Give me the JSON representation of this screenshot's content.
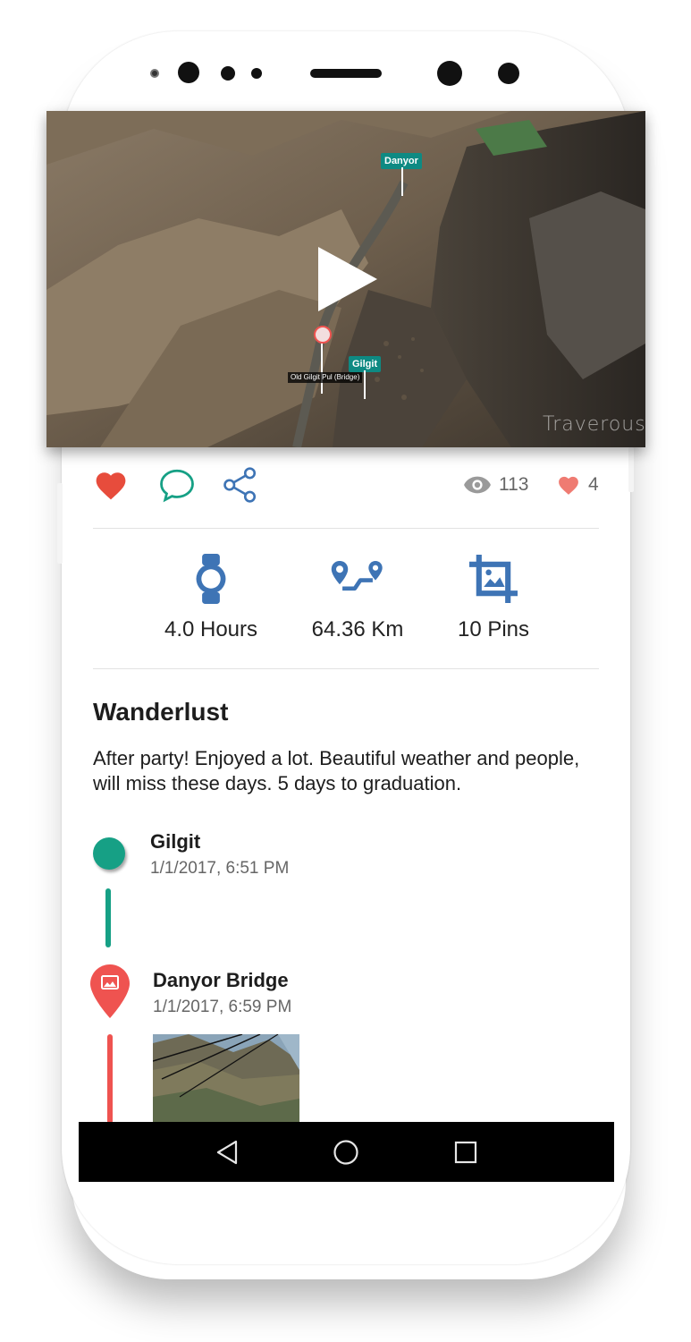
{
  "video": {
    "labels": {
      "danyor": "Danyor",
      "gilgit": "Gilgit",
      "bridge": "Old Gilgit Pul (Bridge)"
    },
    "watermark": "Traverous"
  },
  "actions": {
    "views_count": "113",
    "likes_count": "4"
  },
  "metrics": {
    "duration": "4.0 Hours",
    "distance": "64.36 Km",
    "pins": "10 Pins"
  },
  "post": {
    "title": "Wanderlust",
    "description": "After party! Enjoyed a lot. Beautiful weather and people, will miss these days. 5 days to graduation."
  },
  "timeline": [
    {
      "name": "Gilgit",
      "time": "1/1/2017, 6:51 PM"
    },
    {
      "name": "Danyor Bridge",
      "time": "1/1/2017, 6:59 PM"
    }
  ],
  "colors": {
    "teal": "#16a085",
    "red": "#ef5350",
    "blue": "#3e74b5",
    "label_teal": "#0e8a83"
  },
  "icons": [
    "heart-icon",
    "comment-icon",
    "share-icon",
    "eye-icon",
    "watch-icon",
    "route-icon",
    "crop-image-icon",
    "image-pin-icon",
    "back-icon",
    "home-icon",
    "recents-icon",
    "play-icon"
  ]
}
